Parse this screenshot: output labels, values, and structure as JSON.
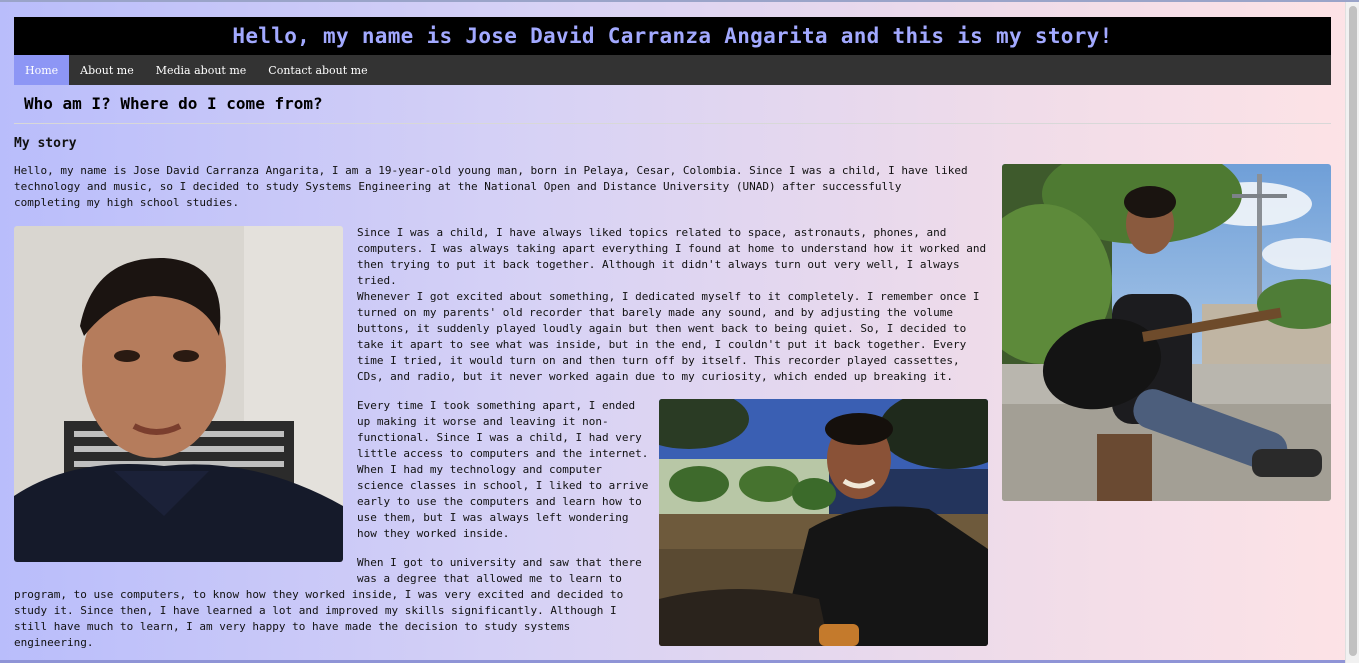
{
  "header": {
    "title": "Hello, my name is Jose David Carranza Angarita and this is my story!"
  },
  "nav": {
    "items": [
      {
        "label": "Home",
        "active": true
      },
      {
        "label": "About me",
        "active": false
      },
      {
        "label": "Media about me",
        "active": false
      },
      {
        "label": "Contact about me",
        "active": false
      }
    ]
  },
  "main": {
    "heading": "Who am I? Where do I come from?",
    "story_title": "My story",
    "paragraphs": [
      "Hello, my name is Jose David Carranza Angarita, I am a 19-year-old young man, born in Pelaya, Cesar, Colombia. Since I was a child, I have liked technology and music, so I decided to study Systems Engineering at the National Open and Distance University (UNAD) after successfully completing my high school studies.",
      "Since I was a child, I have always liked topics related to space, astronauts, phones, and computers. I was always taking apart everything I found at home to understand how it worked and then trying to put it back together. Although it didn't always turn out very well, I always tried.",
      "Whenever I got excited about something, I dedicated myself to it completely. I remember once I turned on my parents' old recorder that barely made any sound, and by adjusting the volume buttons, it suddenly played loudly again but then went back to being quiet. So, I decided to take it apart to see what was inside, but in the end, I couldn't put it back together. Every time I tried, it would turn on and then turn off by itself. This recorder played cassettes, CDs, and radio, but it never worked again due to my curiosity, which ended up breaking it.",
      "Every time I took something apart, I ended up making it worse and leaving it non-functional. Since I was a child, I had very little access to computers and the internet. When I had my technology and computer science classes in school, I liked to arrive early to use the computers and learn how to use them, but I was always left wondering how they worked inside.",
      "When I got to university and saw that there was a degree that allowed me to learn to",
      "program, to use computers, to know how they worked inside, I was very excited and decided to study it. Since then, I have learned a lot and improved my skills significantly. Although I still have much to learn, I am very happy to have made the decision to study systems engineering."
    ]
  },
  "colors": {
    "header_bg": "#000000",
    "title_color": "#a2a9ff",
    "nav_bg": "#333333",
    "nav_active": "#8d96f5"
  },
  "icons": [
    "portrait-photo",
    "guitar-photo",
    "selfie-photo"
  ]
}
